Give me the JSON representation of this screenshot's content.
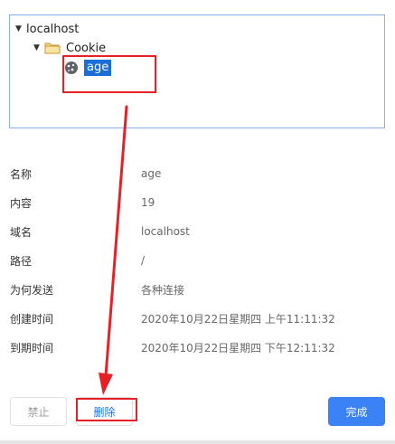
{
  "tree": {
    "root_label": "localhost",
    "folder_label": "Cookie",
    "selected_label": "age"
  },
  "details": {
    "rows": [
      {
        "key": "名称",
        "value": "age"
      },
      {
        "key": "内容",
        "value": "19"
      },
      {
        "key": "域名",
        "value": "localhost"
      },
      {
        "key": "路径",
        "value": "/"
      },
      {
        "key": "为何发送",
        "value": "各种连接"
      },
      {
        "key": "创建时间",
        "value": "2020年10月22日星期四 上午11:11:32"
      },
      {
        "key": "到期时间",
        "value": "2020年10月22日星期四 下午12:11:32"
      }
    ]
  },
  "buttons": {
    "disable": "禁止",
    "delete": "删除",
    "done": "完成"
  },
  "colors": {
    "selection": "#1a6ed8",
    "primary_button": "#3b82f6",
    "annotation_red": "#e52126",
    "tree_border": "#8ab0e6"
  },
  "icons": {
    "expand": "triangle-down",
    "folder": "folder",
    "cookie": "cookie"
  }
}
